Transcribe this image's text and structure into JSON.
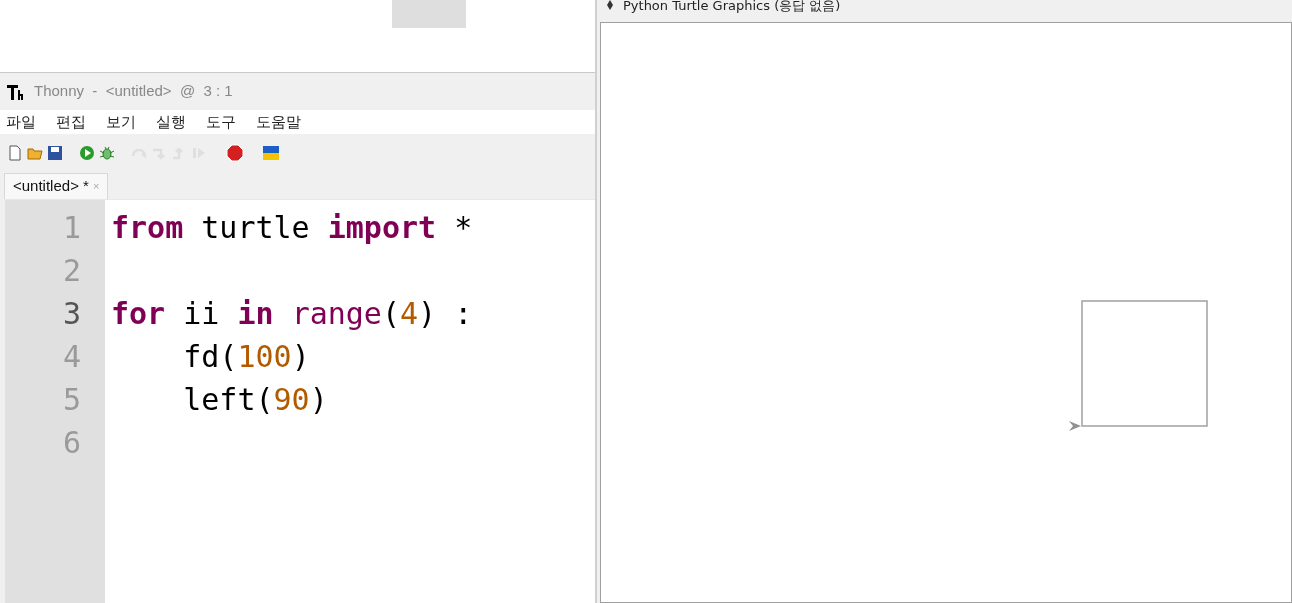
{
  "editor_window": {
    "title": "Thonny  -  <untitled>  @  3 : 1",
    "menu": [
      "파일",
      "편집",
      "보기",
      "실행",
      "도구",
      "도움말"
    ],
    "toolbar": [
      {
        "kind": "new",
        "disabled": false
      },
      {
        "kind": "open",
        "disabled": false
      },
      {
        "kind": "save",
        "disabled": false
      },
      {
        "kind": "run",
        "disabled": false
      },
      {
        "kind": "debug",
        "disabled": false
      },
      {
        "kind": "step-over",
        "disabled": true
      },
      {
        "kind": "step-into",
        "disabled": true
      },
      {
        "kind": "step-out",
        "disabled": true
      },
      {
        "kind": "resume",
        "disabled": true
      },
      {
        "kind": "stop",
        "disabled": false
      },
      {
        "kind": "flag",
        "disabled": false
      }
    ],
    "tabs": [
      {
        "label": "<untitled> *",
        "close": "×",
        "selected": true
      }
    ],
    "lines": [
      {
        "number": "1",
        "current": false,
        "tokens": [
          {
            "text": "from",
            "kind": "keyword"
          },
          {
            "text": " turtle ",
            "kind": "plain"
          },
          {
            "text": "import",
            "kind": "keyword"
          },
          {
            "text": " *",
            "kind": "plain"
          }
        ]
      },
      {
        "number": "2",
        "current": false
      },
      {
        "number": "3",
        "current": true,
        "tokens": [
          {
            "text": "for",
            "kind": "keyword"
          },
          {
            "text": " ii ",
            "kind": "plain"
          },
          {
            "text": "in ",
            "kind": "keyword"
          },
          {
            "text": "range",
            "kind": "builtin"
          },
          {
            "text": "(",
            "kind": "plain"
          },
          {
            "text": "4",
            "kind": "number"
          },
          {
            "text": ") :",
            "kind": "plain"
          }
        ]
      },
      {
        "number": "4",
        "current": false,
        "tokens": [
          {
            "text": "    fd(",
            "kind": "plain"
          },
          {
            "text": "100",
            "kind": "number"
          },
          {
            "text": ")",
            "kind": "plain"
          }
        ]
      },
      {
        "number": "5",
        "current": false,
        "tokens": [
          {
            "text": "    left(",
            "kind": "plain"
          },
          {
            "text": "90",
            "kind": "number"
          },
          {
            "text": ")",
            "kind": "plain"
          }
        ]
      },
      {
        "number": "6",
        "current": false
      }
    ]
  },
  "turtle_window": {
    "title": "Python Turtle Graphics (응답 없음)"
  }
}
